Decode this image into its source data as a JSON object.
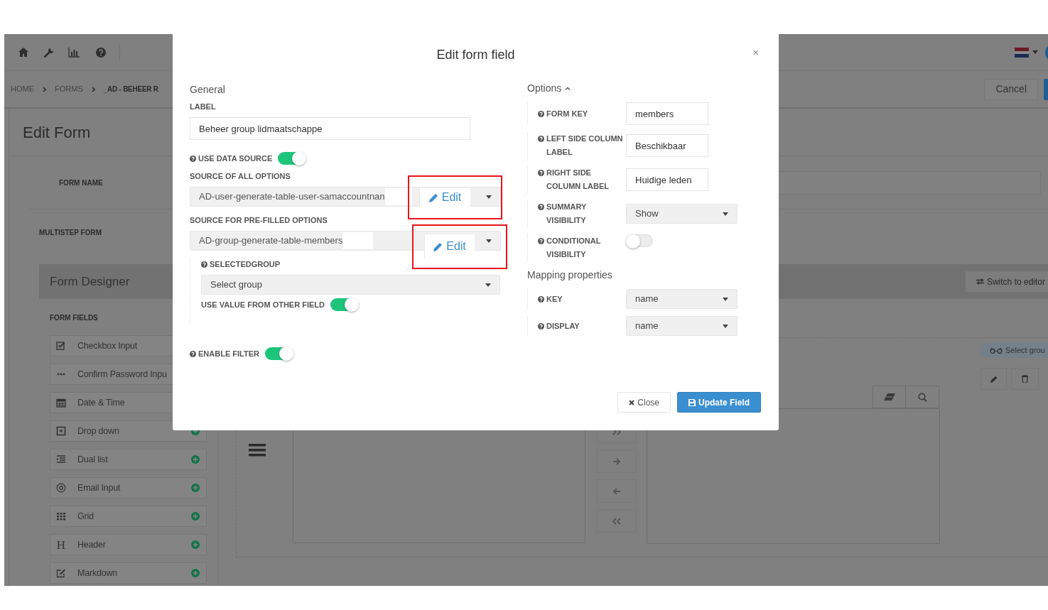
{
  "breadcrumb": [
    {
      "label": "HOME",
      "current": false
    },
    {
      "label": "FORMS",
      "current": false
    },
    {
      "label": "_AD - BEHEER R",
      "current": true
    }
  ],
  "cancel_button": "Cancel",
  "page_title": "Edit Form",
  "form_rows": [
    {
      "kind": "input",
      "label": "FORM NAME"
    },
    {
      "kind": "plain",
      "label": "MULTISTEP FORM"
    }
  ],
  "designer": {
    "title": "Form Designer",
    "switch_button": "Switch to editor",
    "fields_heading": "FORM FIELDS",
    "fields": [
      {
        "kind": "checkbox",
        "label": "Checkbox Input"
      },
      {
        "kind": "password",
        "label": "Confirm Password Inpu"
      },
      {
        "kind": "datetime",
        "label": "Date & Time"
      },
      {
        "kind": "dropdown",
        "label": "Drop down",
        "add_visible": true
      },
      {
        "kind": "duallist",
        "label": "Dual list",
        "add_visible": true
      },
      {
        "kind": "email",
        "label": "Email Input",
        "add_visible": true
      },
      {
        "kind": "grid",
        "label": "Grid",
        "add_visible": true
      },
      {
        "kind": "header",
        "label": "Header",
        "glyph": "H",
        "add_visible": true
      },
      {
        "kind": "markdown",
        "label": "Markdown",
        "add_visible": true
      }
    ],
    "badge": "Select grou"
  },
  "modal": {
    "title": "Edit form field",
    "close_symbol": "×",
    "left": [
      {
        "kind": "heading",
        "text": "General"
      },
      {
        "kind": "input",
        "label": "LABEL",
        "value": "Beheer group lidmaatschappe"
      },
      {
        "kind": "toggle",
        "label": "USE DATA SOURCE",
        "help": true,
        "on": true
      },
      {
        "kind": "source",
        "label": "SOURCE OF ALL OPTIONS",
        "value": "AD-user-generate-table-user-samaccountnan",
        "button": "Edit",
        "highlighted": true
      },
      {
        "kind": "source",
        "label": "SOURCE FOR PRE-FILLED OPTIONS",
        "value": "AD-group-generate-table-members",
        "button": "Edit",
        "highlighted": true,
        "children": [
          {
            "kind": "select",
            "label": "SELECTEDGROUP",
            "help": true,
            "value": "Select group"
          },
          {
            "kind": "toggle",
            "label": "USE VALUE FROM OTHER FIELD",
            "help": false,
            "on": true
          }
        ]
      },
      {
        "kind": "toggle",
        "label": "ENABLE FILTER",
        "help": true,
        "on": true
      }
    ],
    "options": {
      "heading": "Options",
      "expanded": true,
      "rows": [
        {
          "kind": "input",
          "label": "FORM KEY",
          "value": "members"
        },
        {
          "kind": "input",
          "label": "LEFT SIDE COLUMN LABEL",
          "value": "Beschikbaar"
        },
        {
          "kind": "input",
          "label": "RIGHT SIDE COLUMN LABEL",
          "value": "Huidige leden"
        },
        {
          "kind": "select",
          "label": "SUMMARY VISIBILITY",
          "value": "Show"
        },
        {
          "kind": "toggle",
          "label": "CONDITIONAL VISIBILITY",
          "on": false
        }
      ]
    },
    "mapping": {
      "heading": "Mapping properties",
      "rows": [
        {
          "kind": "select",
          "label": "KEY",
          "value": "name"
        },
        {
          "kind": "select",
          "label": "DISPLAY",
          "value": "name"
        }
      ]
    },
    "footer_buttons": [
      {
        "kind": "secondary",
        "label": "Close"
      },
      {
        "kind": "primary",
        "label": "Update Field"
      }
    ]
  }
}
